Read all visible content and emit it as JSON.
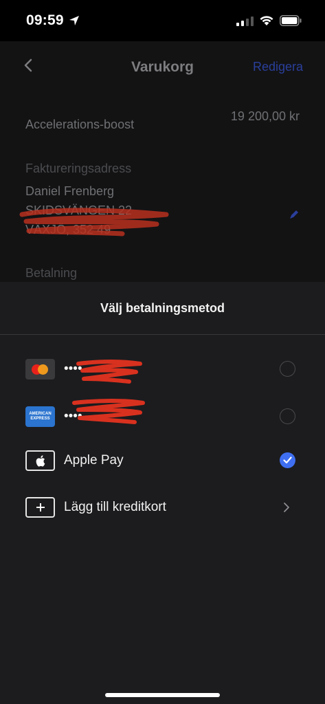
{
  "status_bar": {
    "time": "09:59"
  },
  "background_screen": {
    "nav": {
      "title": "Varukorg",
      "edit_label": "Redigera"
    },
    "item": {
      "name": "Accelerations-boost",
      "price": "19 200,00 kr"
    },
    "billing": {
      "label": "Faktureringsadress",
      "name": "Daniel Frenberg",
      "street": "SKIDSVÄNGEN 22",
      "city": "VÄXJÖ, 352 49"
    },
    "payment_label": "Betalning"
  },
  "sheet": {
    "title": "Välj betalningsmetod",
    "methods": [
      {
        "icon": "mastercard-icon",
        "label": "••••",
        "selected": false
      },
      {
        "icon": "amex-icon",
        "label": "••••",
        "selected": false,
        "card_text": "AMERICAN EXPRESS"
      },
      {
        "icon": "apple-icon",
        "label": "Apple Pay",
        "selected": true
      },
      {
        "icon": "plus-icon",
        "label": "Lägg till kreditkort"
      }
    ]
  },
  "colors": {
    "sheet_bg": "#1c1c1e",
    "accent": "#3f6ff0",
    "redaction": "#d9311f",
    "edit_link": "#2a3f9b"
  }
}
